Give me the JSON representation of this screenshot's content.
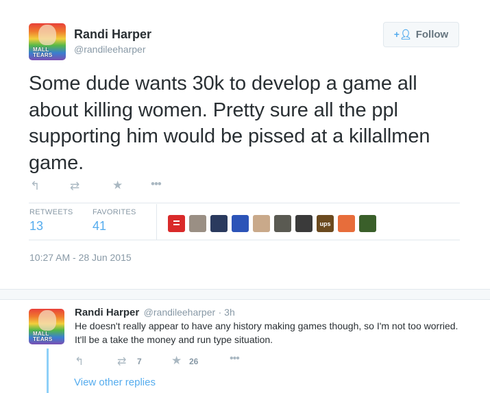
{
  "tweet": {
    "author_name": "Randi Harper",
    "author_handle": "@randileeharper",
    "avatar_caption": "MALL TEARS",
    "follow_label": "Follow",
    "text": "Some dude wants 30k to develop a game all about killing women. Pretty sure all the ppl supporting him would be pissed at a killallmen game.",
    "actions": [
      "reply-icon",
      "retweet-icon",
      "favorite-icon",
      "more-icon"
    ],
    "stats": {
      "retweets_label": "RETWEETS",
      "retweets_count": "13",
      "favorites_label": "FAVORITES",
      "favorites_count": "41"
    },
    "favoriter_avatars": [
      {
        "color": "#d92a2a",
        "symbol": "="
      },
      {
        "color": "#9a8f84",
        "symbol": ""
      },
      {
        "color": "#2a3a5e",
        "symbol": ""
      },
      {
        "color": "#2c54b8",
        "symbol": ""
      },
      {
        "color": "#c9a98a",
        "symbol": ""
      },
      {
        "color": "#5a5a52",
        "symbol": ""
      },
      {
        "color": "#3a3a3a",
        "symbol": ""
      },
      {
        "color": "#6b4a1f",
        "symbol": "ups"
      },
      {
        "color": "#e76d3b",
        "symbol": ""
      },
      {
        "color": "#3a5f2a",
        "symbol": ""
      }
    ],
    "timestamp": "10:27 AM - 28 Jun 2015"
  },
  "reply": {
    "author_name": "Randi Harper",
    "author_handle": "@randileeharper",
    "time_ago": "· 3h",
    "avatar_caption": "MALL TEARS",
    "text": "He doesn't really appear to have any history making games though, so I'm not too worried. It'll be a take the money and run type situation.",
    "retweet_count": "7",
    "favorite_count": "26",
    "view_other_replies": "View other replies"
  },
  "colors": {
    "accent": "#55acee",
    "text": "#292f33",
    "muted": "#8899a6",
    "border": "#e1e8ed",
    "icon": "#aab8c2"
  }
}
